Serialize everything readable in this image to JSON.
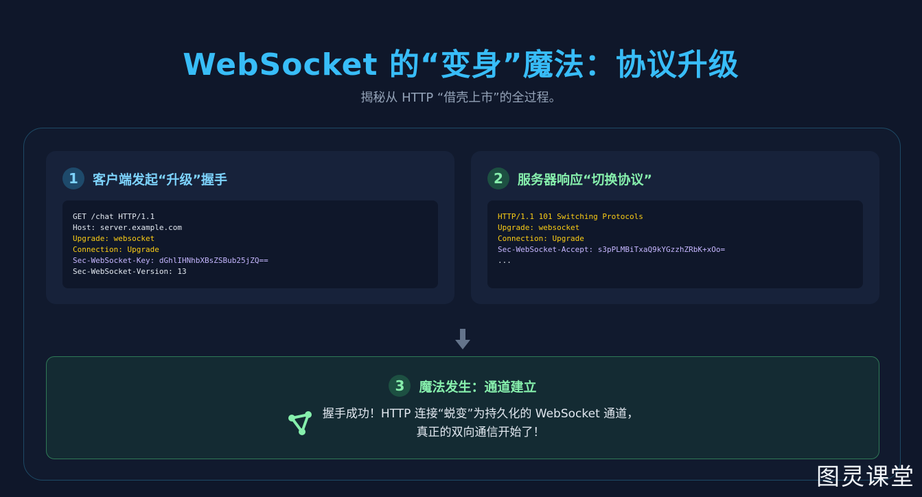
{
  "header": {
    "title": "WebSocket 的“变身”魔法：协议升级",
    "subtitle": "揭秘从 HTTP “借壳上市”的全过程。"
  },
  "steps": [
    {
      "number": "1",
      "title": "客户端发起“升级”握手",
      "code": [
        {
          "text": "GET /chat HTTP/1.1",
          "color": "white"
        },
        {
          "text": "Host: server.example.com",
          "color": "white"
        },
        {
          "text": "Upgrade: websocket",
          "color": "yellow"
        },
        {
          "text": "Connection: Upgrade",
          "color": "yellow"
        },
        {
          "text": "Sec-WebSocket-Key: dGhlIHNhbXBsZSBub25jZQ==",
          "color": "purple"
        },
        {
          "text": "Sec-WebSocket-Version: 13",
          "color": "white"
        }
      ]
    },
    {
      "number": "2",
      "title": "服务器响应“切换协议”",
      "code": [
        {
          "text": "HTTP/1.1 101 Switching Protocols",
          "color": "yellow"
        },
        {
          "text": "Upgrade: websocket",
          "color": "yellow"
        },
        {
          "text": "Connection: Upgrade",
          "color": "yellow"
        },
        {
          "text": "Sec-WebSocket-Accept: s3pPLMBiTxaQ9kYGzzhZRbK+xOo=",
          "color": "purple"
        },
        {
          "text": "...",
          "color": "white"
        }
      ]
    }
  ],
  "result": {
    "number": "3",
    "title": "魔法发生：通道建立",
    "line1": "握手成功！HTTP 连接“蜕变”为持久化的 WebSocket 通道，",
    "line2": "真正的双向通信开始了！"
  },
  "icons": {
    "arrow": "arrow-down-icon",
    "result": "connection-network-icon"
  },
  "colors": {
    "accent_blue": "#38bdf8",
    "accent_green": "#86efac",
    "code_yellow": "#facc15",
    "code_purple": "#c4b5fd"
  },
  "watermark": "图灵课堂"
}
